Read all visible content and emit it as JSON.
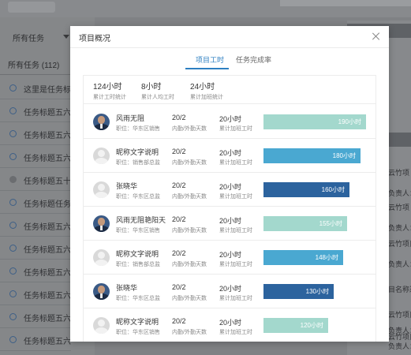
{
  "background": {
    "filter": {
      "label": "所有任务"
    },
    "all_tasks": {
      "label": "所有任务 (112)"
    },
    "tasks": [
      {
        "label": "这里是任务标题"
      },
      {
        "label": "任务标题五六七八"
      },
      {
        "label": "任务标题五六七八"
      },
      {
        "label": "任务标题五六七八"
      },
      {
        "label": "任务标题五十一"
      },
      {
        "label": "任务标题任务标题"
      },
      {
        "label": "任务标题五六七八"
      },
      {
        "label": "任务标题五六七八"
      },
      {
        "label": "任务标题五六七八"
      },
      {
        "label": "任务标题五六七八"
      },
      {
        "label": "任务标题五六七八"
      },
      {
        "label": "任务标题五六七八"
      }
    ],
    "right_panel": {
      "lines": [
        "云竹项",
        "负责人：赵云",
        "云竹项",
        "负责人：赵云",
        "云竹项目",
        "负责人：赵云",
        "目名称过",
        "云竹项目",
        "负责人：赵云",
        "云竹项目",
        "负责人：赵云",
        "云竹项目",
        "负责人：赵云"
      ]
    }
  },
  "modal": {
    "title": "项目概况",
    "tabs": [
      {
        "label": "项目工时",
        "active": true
      },
      {
        "label": "任务完成率",
        "active": false
      }
    ],
    "summary": [
      {
        "value": "124小时",
        "label": "累计工时统计"
      },
      {
        "value": "8小时",
        "label": "累计人均工时"
      },
      {
        "value": "24小时",
        "label": "累计加班统计"
      }
    ],
    "rows": [
      {
        "name": "风雨无阻",
        "role": "职位：华东区销售",
        "tasks": "20/2",
        "tasks_label": "内勤/外勤天数",
        "overtime": "20小时",
        "overtime_label": "累计加班工时",
        "hours": "190小时",
        "bar_value": 190,
        "bar_color": "#a3d8cd",
        "avatar": "photo"
      },
      {
        "name": "昵称文字说明",
        "role": "职位：销售部总监",
        "tasks": "20/2",
        "tasks_label": "内勤/外勤天数",
        "overtime": "20小时",
        "overtime_label": "累计加班工时",
        "hours": "180小时",
        "bar_value": 180,
        "bar_color": "#4aa8d1",
        "avatar": "gray"
      },
      {
        "name": "张晓华",
        "role": "职位：华东区总监",
        "tasks": "20/2",
        "tasks_label": "内勤/外勤天数",
        "overtime": "20小时",
        "overtime_label": "累计加班工时",
        "hours": "160小时",
        "bar_value": 160,
        "bar_color": "#2c639e",
        "avatar": "gray"
      },
      {
        "name": "风雨无阻艳阳天",
        "role": "职位：华东区销售",
        "tasks": "20/2",
        "tasks_label": "内勤/外勤天数",
        "overtime": "20小时",
        "overtime_label": "累计加班工时",
        "hours": "155小时",
        "bar_value": 155,
        "bar_color": "#a3d8cd",
        "avatar": "photo"
      },
      {
        "name": "昵称文字说明",
        "role": "职位：销售部总监",
        "tasks": "20/2",
        "tasks_label": "内勤/外勤天数",
        "overtime": "20小时",
        "overtime_label": "累计加班工时",
        "hours": "148小时",
        "bar_value": 148,
        "bar_color": "#4aa8d1",
        "avatar": "gray"
      },
      {
        "name": "张晓华",
        "role": "职位：华东区总监",
        "tasks": "20/2",
        "tasks_label": "内勤/外勤天数",
        "overtime": "20小时",
        "overtime_label": "累计加班工时",
        "hours": "130小时",
        "bar_value": 130,
        "bar_color": "#2c639e",
        "avatar": "photo"
      },
      {
        "name": "昵称文字说明",
        "role": "职位：华东区销售",
        "tasks": "20/2",
        "tasks_label": "内勤/外勤天数",
        "overtime": "20小时",
        "overtime_label": "累计加班工时",
        "hours": "120小时",
        "bar_value": 120,
        "bar_color": "#a3d8cd",
        "avatar": "gray"
      }
    ]
  }
}
